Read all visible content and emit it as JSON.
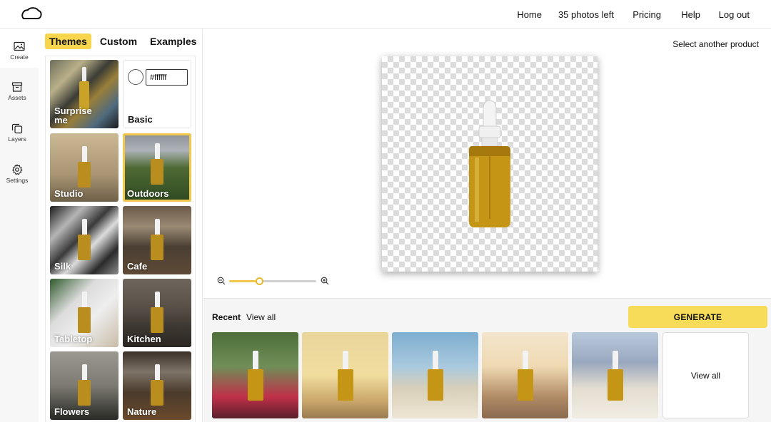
{
  "nav": {
    "home": "Home",
    "photos_left": "35 photos left",
    "pricing": "Pricing",
    "help": "Help",
    "logout": "Log out"
  },
  "rail": {
    "items": [
      {
        "label": "Create",
        "icon": "image-icon"
      },
      {
        "label": "Assets",
        "icon": "archive-icon"
      },
      {
        "label": "Layers",
        "icon": "layers-icon"
      },
      {
        "label": "Settings",
        "icon": "gear-icon"
      }
    ]
  },
  "theme_tabs": [
    "Themes",
    "Custom",
    "Examples"
  ],
  "basic": {
    "color_value": "#ffffff",
    "label": "Basic"
  },
  "themes": [
    {
      "label": "Surprise me"
    },
    {
      "label": "Basic"
    },
    {
      "label": "Studio"
    },
    {
      "label": "Outdoors",
      "selected": true
    },
    {
      "label": "Silk"
    },
    {
      "label": "Cafe"
    },
    {
      "label": "Tabletop"
    },
    {
      "label": "Kitchen"
    },
    {
      "label": "Flowers"
    },
    {
      "label": "Nature"
    }
  ],
  "main": {
    "select_product": "Select another product",
    "zoom_level": 0.35
  },
  "bottom": {
    "recent_label": "Recent",
    "view_all_link": "View all",
    "generate_label": "GENERATE",
    "view_all_card": "View all"
  },
  "colors": {
    "accent": "#f7dc5a",
    "selected_border": "#f2c94c"
  }
}
